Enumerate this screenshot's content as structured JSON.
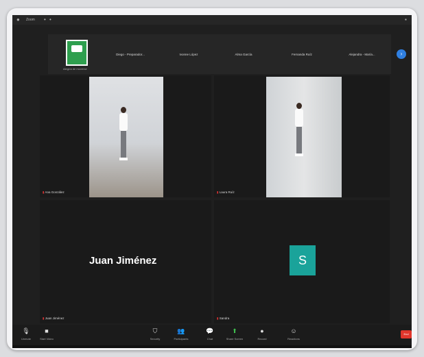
{
  "titlebar": {
    "title": "Zoom"
  },
  "strip": {
    "logo_caption": "Alegría de moverse",
    "participants": [
      "Diego - Preparador...",
      "Ivonne López",
      "Alma García",
      "Fernanda Ruíz",
      "Alejandra - María..."
    ]
  },
  "tiles": [
    {
      "name": "Ana González"
    },
    {
      "name": "Laura Ruíz"
    },
    {
      "name": "Juan Jiménez",
      "display_name": "Juan Jiménez"
    },
    {
      "name": "Sandra",
      "initial": "S"
    }
  ],
  "toolbar": {
    "buttons": [
      {
        "label": "Unmute",
        "icon": "mic-icon"
      },
      {
        "label": "Start Video",
        "icon": "video-icon"
      },
      {
        "label": "Security",
        "icon": "shield-icon"
      },
      {
        "label": "Participants",
        "icon": "people-icon"
      },
      {
        "label": "Chat",
        "icon": "chat-icon"
      },
      {
        "label": "Share Screen",
        "icon": "share-icon"
      },
      {
        "label": "Record",
        "icon": "record-icon"
      },
      {
        "label": "Reactions",
        "icon": "reactions-icon"
      }
    ],
    "end_label": "End"
  },
  "colors": {
    "accent": "#3fbf4f",
    "avatar": "#1aa39a",
    "end": "#e0362c"
  }
}
